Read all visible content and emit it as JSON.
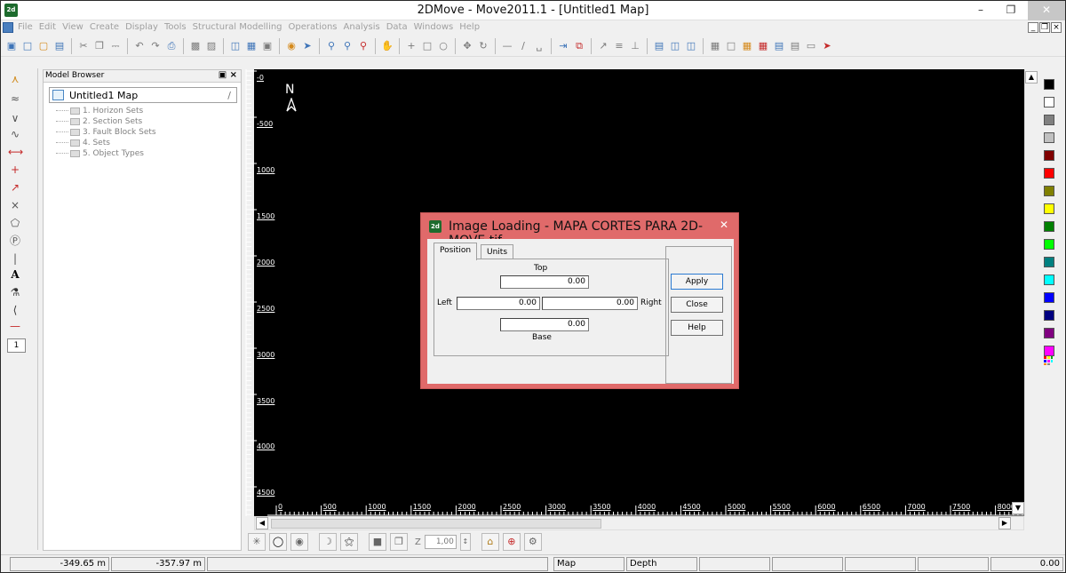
{
  "window": {
    "title": "2DMove - Move2011.1 - [Untitled1 Map]",
    "app_icon": "2d"
  },
  "menu": {
    "items": [
      "File",
      "Edit",
      "View",
      "Create",
      "Display",
      "Tools",
      "Structural Modelling",
      "Operations",
      "Analysis",
      "Data",
      "Windows",
      "Help"
    ]
  },
  "browser": {
    "title": "Model Browser",
    "root": "Untitled1 Map",
    "items": [
      "1. Horizon Sets",
      "2. Section Sets",
      "3. Fault Block Sets",
      "4. Sets",
      "5. Object Types"
    ]
  },
  "canvas": {
    "north_label": "N",
    "vruler_labels": [
      "-0",
      "-500",
      "1000",
      "1500",
      "2000",
      "2500",
      "3000",
      "3500",
      "4000",
      "4500"
    ],
    "hruler_labels": [
      "0",
      "500",
      "1000",
      "1500",
      "2000",
      "2500",
      "3000",
      "3500",
      "4000",
      "4500",
      "5000",
      "5500",
      "6000",
      "6500",
      "7000",
      "7500",
      "8000"
    ]
  },
  "layer": {
    "value": "1"
  },
  "colors": [
    "#000000",
    "#ffffff",
    "#808080",
    "#c0c0c0",
    "#800000",
    "#ff0000",
    "#808000",
    "#ffff00",
    "#008000",
    "#00ff00",
    "#008080",
    "#00ffff",
    "#0000ff",
    "#000080",
    "#800080",
    "#ff00ff"
  ],
  "dialog": {
    "title": "Image Loading - MAPA CORTES PARA 2D-MOVE.tif",
    "tabs": [
      "Position",
      "Units"
    ],
    "top_label": "Top",
    "top_value": "0.00",
    "left_label": "Left",
    "left_value": "0.00",
    "right_label": "Right",
    "right_value": "0.00",
    "base_label": "Base",
    "base_value": "0.00",
    "buttons": {
      "apply": "Apply",
      "close": "Close",
      "help": "Help"
    }
  },
  "bottom": {
    "z_label": "Z",
    "z_value": "1,00"
  },
  "status": {
    "x": "-349.65 m",
    "y": "-357.97 m",
    "view": "Map",
    "mode": "Depth",
    "value": "0.00"
  }
}
